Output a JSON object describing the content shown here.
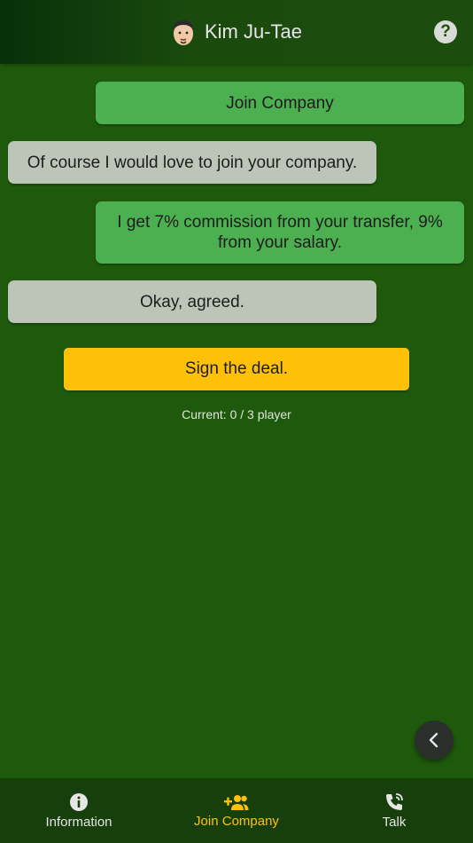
{
  "header": {
    "title": "Kim Ju-Tae",
    "avatar_icon": "avatar-face-icon",
    "help_icon": "help-circle-icon",
    "help_symbol": "?"
  },
  "chat": {
    "messages": [
      {
        "from": "me",
        "text": "Join Company"
      },
      {
        "from": "them",
        "text": "Of course I would love to join your company."
      },
      {
        "from": "me",
        "text": "I get 7% commission from your transfer, 9% from your salary."
      },
      {
        "from": "them",
        "text": "Okay, agreed."
      }
    ]
  },
  "action": {
    "sign_label": "Sign the deal."
  },
  "status": {
    "text": "Current: 0 / 3 player"
  },
  "fab": {
    "icon": "chevron-left-icon"
  },
  "nav": {
    "items": [
      {
        "label": "Information",
        "icon": "info-icon",
        "active": false
      },
      {
        "label": "Join Company",
        "icon": "add-group-icon",
        "active": true
      },
      {
        "label": "Talk",
        "icon": "phone-icon",
        "active": false
      }
    ]
  },
  "colors": {
    "background": "#1f5a0c",
    "my_bubble": "#4caf50",
    "their_bubble": "#bcc5b8",
    "accent": "#ffc107",
    "nav_bg": "#173f0b"
  }
}
